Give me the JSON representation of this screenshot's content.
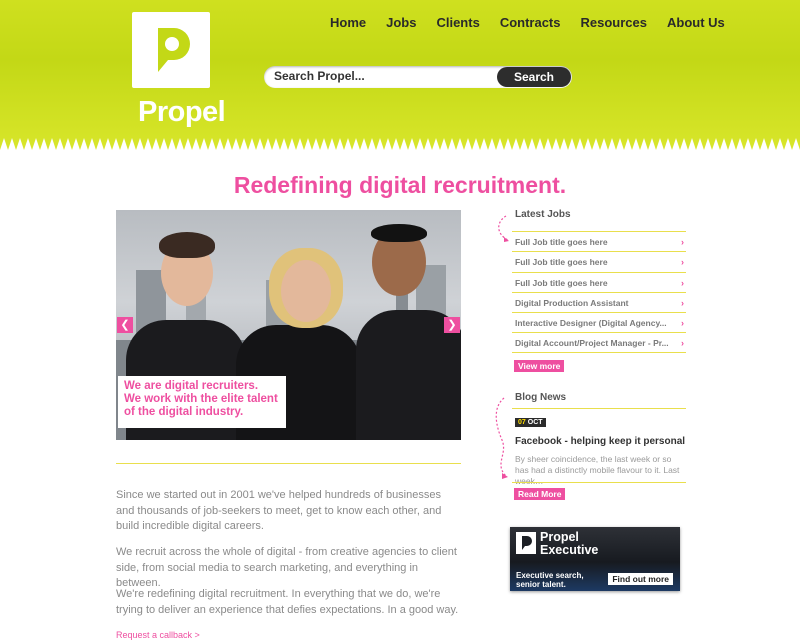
{
  "brand": {
    "logo_text": "Propel"
  },
  "nav": [
    "Home",
    "Jobs",
    "Clients",
    "Contracts",
    "Resources",
    "About Us"
  ],
  "search": {
    "placeholder": "Search Propel...",
    "button_label": "Search"
  },
  "headline": "Redefining digital recruitment.",
  "hero": {
    "caption_lines": [
      "We are digital recruiters.",
      "We work with the elite talent",
      "of the digital industry."
    ],
    "prev_icon": "chevron-left-icon",
    "next_icon": "chevron-right-icon"
  },
  "intro_paragraphs": [
    "Since we started out in 2001 we've helped hundreds of businesses and thousands of job-seekers to meet, get to know each other, and build incredible digital careers.",
    "We recruit across the whole of digital - from creative agencies to client side, from social media to search marketing, and everything in between.",
    "We're redefining digital recruitment. In everything that we do, we're trying to deliver an experience that defies expectations. In a good way."
  ],
  "callback_link": "Request a callback >",
  "latest_jobs": {
    "title": "Latest Jobs",
    "items": [
      "Full Job title goes here",
      "Full Job title goes here",
      "Full Job title goes here",
      "Digital Production Assistant",
      "Interactive Designer (Digital Agency...",
      "Digital Account/Project Manager - Pr..."
    ],
    "view_more": "View more"
  },
  "blog": {
    "title": "Blog News",
    "date_day": "07",
    "date_month": "OCT",
    "post_title": "Facebook - helping keep it personal",
    "excerpt": "By sheer coincidence, the last week or so has had a distinctly mobile flavour to it. Last week…",
    "read_more": "Read More"
  },
  "executive": {
    "title": "Propel Executive",
    "tagline": "Executive search, senior talent.",
    "button": "Find out more"
  },
  "colors": {
    "accent_pink": "#ee4fa0",
    "header_lime": "#c9dc1c",
    "divider_yellow": "#e9df4d"
  }
}
